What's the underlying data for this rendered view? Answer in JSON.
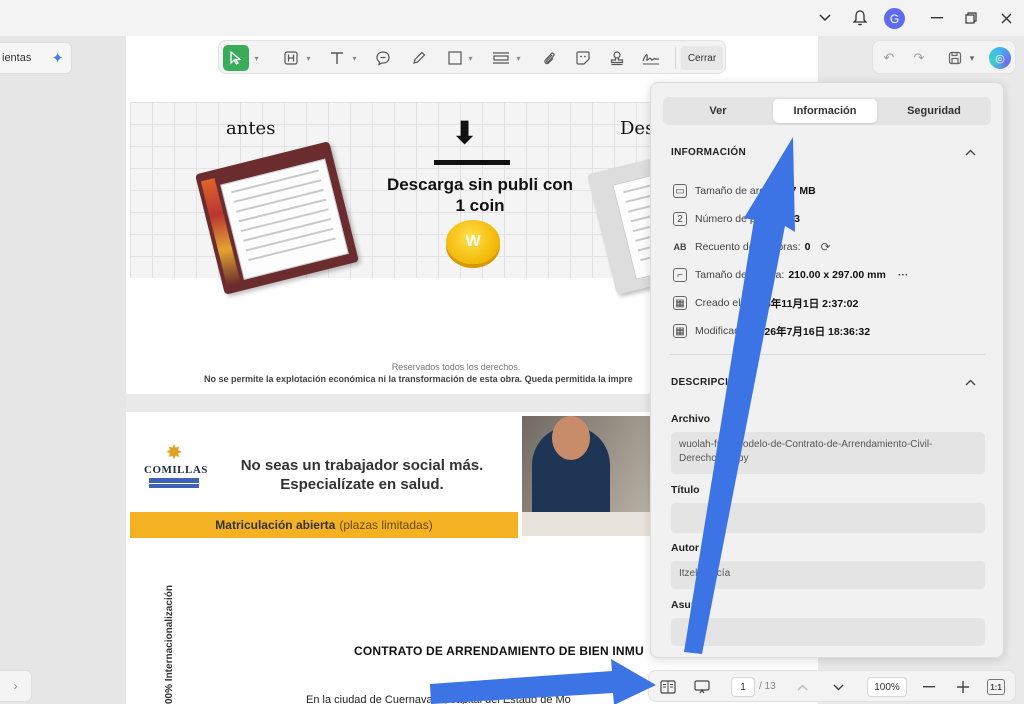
{
  "titlebar": {
    "avatar_letter": "G"
  },
  "left_panel": {
    "herramientas_label": "ientas"
  },
  "annotation_toolbar": {
    "close_label": "Cerrar"
  },
  "document": {
    "ad1": {
      "before_label": "antes",
      "after_label": "Des",
      "headline": "Descarga sin publi con 1 coin",
      "coin_letter": "W"
    },
    "reserved_text": "Reservados todos los derechos.",
    "notice_text": "No se permite la explotación económica ni la transformación de esta obra. Queda permitida la impre",
    "ad2": {
      "logo_name": "COMILLAS",
      "headline": "No seas un trabajador social más. Especialízate en salud.",
      "strip_bold": "Matriculación abierta",
      "strip_light": "(plazas limitadas)"
    },
    "vertical_text": "00% Internacionalización",
    "contract_title": "CONTRATO DE ARRENDAMIENTO DE BIEN INMU",
    "contract_body": "En la ciudad de Cuernavaca, capital del Estado de Mo"
  },
  "info_panel": {
    "tabs": [
      {
        "label": "Ver",
        "active": false
      },
      {
        "label": "Información",
        "active": true
      },
      {
        "label": "Seguridad",
        "active": false
      }
    ],
    "info_section_title": "INFORMACIÓN",
    "rows": [
      {
        "label": "Tamaño de archivo:",
        "value": "7 MB",
        "icon": "file-size-icon"
      },
      {
        "label": "Número de página:",
        "value": "13",
        "icon": "page-number-icon"
      },
      {
        "label": "Recuento de palabras:",
        "value": "0",
        "icon": "word-count-icon"
      },
      {
        "label": "Tamaño de página:",
        "value": "210.00 x 297.00 mm",
        "extra": "···",
        "icon": "page-size-icon"
      },
      {
        "label": "Creado el:",
        "value": "2026年11月1日 2:37:02",
        "icon": "calendar-icon"
      },
      {
        "label": "Modificado:",
        "value": "2026年7月16日 18:36:32",
        "icon": "calendar-icon"
      }
    ],
    "desc_section_title": "DESCRIPCIÓN",
    "fields": [
      {
        "label": "Archivo",
        "value": "wuolah-free-Modelo-de-Contrato-de-Arrendamiento-Civil-Derechos-Copy"
      },
      {
        "label": "Título",
        "value": ""
      },
      {
        "label": "Autor",
        "value": "Itzel García"
      },
      {
        "label": "Asunto",
        "value": ""
      }
    ]
  },
  "bottom_bar": {
    "current_page": "1",
    "total_pages": "/ 13",
    "zoom": "100%",
    "fit_label": "1:1"
  },
  "colors": {
    "accent_green": "#3aaa5b",
    "arrow_blue": "#3c74e6",
    "ad_yellow": "#f4b223"
  }
}
